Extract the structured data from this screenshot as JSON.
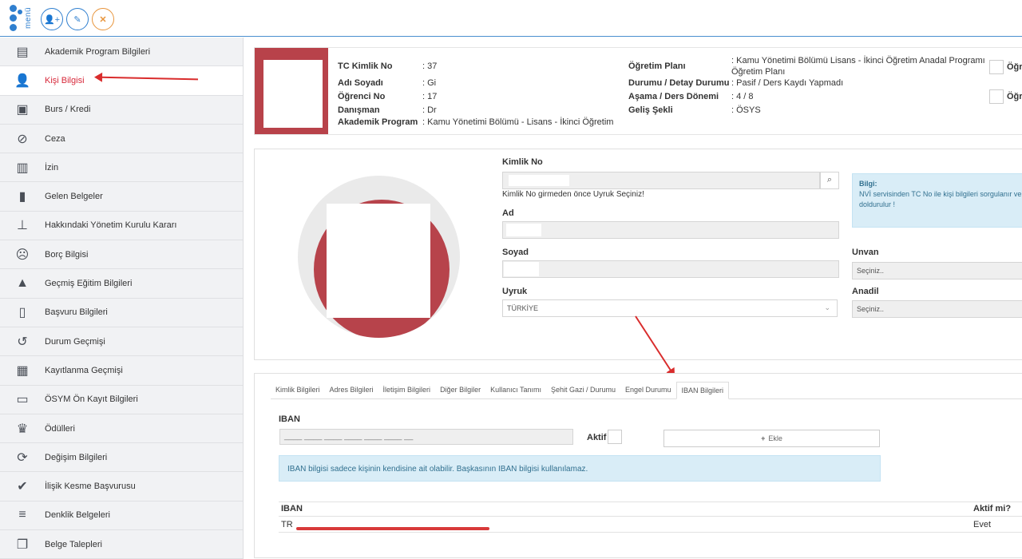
{
  "topbar": {
    "menu_label": "menü",
    "buttons": [
      "add-user",
      "edit",
      "close"
    ]
  },
  "sidebar": {
    "items": [
      {
        "label": "Akademik Program Bilgileri",
        "icon": "table-icon",
        "glyph": "▤"
      },
      {
        "label": "Kişi Bilgisi",
        "icon": "user-icon",
        "glyph": "👤"
      },
      {
        "label": "Burs / Kredi",
        "icon": "money-icon",
        "glyph": "▣"
      },
      {
        "label": "Ceza",
        "icon": "ban-icon",
        "glyph": "⊘"
      },
      {
        "label": "İzin",
        "icon": "briefcase-icon",
        "glyph": "▥"
      },
      {
        "label": "Gelen Belgeler",
        "icon": "file-icon",
        "glyph": "▮"
      },
      {
        "label": "Hakkındaki Yönetim Kurulu Kararı",
        "icon": "pin-icon",
        "glyph": "⊥"
      },
      {
        "label": "Borç Bilgisi",
        "icon": "frown-icon",
        "glyph": "☹"
      },
      {
        "label": "Geçmiş Eğitim Bilgileri",
        "icon": "graduation-cap-icon",
        "glyph": "▲"
      },
      {
        "label": "Başvuru Bilgileri",
        "icon": "document-icon",
        "glyph": "▯"
      },
      {
        "label": "Durum Geçmişi",
        "icon": "history-icon",
        "glyph": "↺"
      },
      {
        "label": "Kayıtlanma Geçmişi",
        "icon": "calendar-check-icon",
        "glyph": "▦"
      },
      {
        "label": "ÖSYM Ön Kayıt Bilgileri",
        "icon": "archive-icon",
        "glyph": "▭"
      },
      {
        "label": "Ödülleri",
        "icon": "trophy-icon",
        "glyph": "♛"
      },
      {
        "label": "Değişim Bilgileri",
        "icon": "refresh-icon",
        "glyph": "⟳"
      },
      {
        "label": "İlişik Kesme Başvurusu",
        "icon": "check-icon",
        "glyph": "✔"
      },
      {
        "label": "Denklik Belgeleri",
        "icon": "bars-icon",
        "glyph": "≡"
      },
      {
        "label": "Belge Talepleri",
        "icon": "copy-icon",
        "glyph": "❐"
      }
    ],
    "active_index": 1
  },
  "student": {
    "tc_label": "TC Kimlik No",
    "tc_value": ": 37",
    "name_label": "Adı Soyadı",
    "name_value": ": Gi",
    "no_label": "Öğrenci No",
    "no_value": ": 17",
    "advisor_label": "Danışman",
    "advisor_value": ": Dr",
    "program_label": "Akademik Program",
    "program_value": ": Kamu Yönetimi Bölümü - Lisans - İkinci Öğretim",
    "plan_label": "Öğretim Planı",
    "plan_value_1": ": Kamu Yönetimi Bölümü Lisans - İkinci Öğretim Anadal Programı",
    "plan_value_2": "Öğretim Planı",
    "status_label": "Durumu / Detay Durumu",
    "status_value": ": Pasif / Ders Kaydı Yapmadı",
    "stage_label": "Aşama / Ders Dönemi",
    "stage_value": ": 4 / 8",
    "entry_label": "Geliş Şekli",
    "entry_value": ": ÖSYS",
    "right_cut_1": "Öğre",
    "right_cut_2": "Öğre"
  },
  "identity": {
    "kimlik_label": "Kimlik No",
    "kimlik_hint": "Kimlik No girmeden önce Uyruk Seçiniz!",
    "ad_label": "Ad",
    "ad_value": "·",
    "soyad_label": "Soyad",
    "uyruk_label": "Uyruk",
    "uyruk_value": "TÜRKİYE",
    "unvan_label": "Unvan",
    "unvan_value": "Seçiniz..",
    "anadil_label": "Anadil",
    "anadil_value": "Seçiniz..",
    "info_title": "Bilgi:",
    "info_text_1": "NVİ servisinden TC No ile kişi bilgileri sorgulanır ve e",
    "info_text_2": "doldurulur !"
  },
  "tabs": [
    "Kimlik Bilgileri",
    "Adres Bilgileri",
    "İletişim Bilgileri",
    "Diğer Bilgiler",
    "Kullanıcı Tanımı",
    "Şehit Gazi / Durumu",
    "Engel Durumu",
    "IBAN Bilgileri"
  ],
  "active_tab": 7,
  "iban": {
    "label": "IBAN",
    "mask": "____ ____ ____ ____ ____ ____ __",
    "aktif_label": "Aktif",
    "add_label": "Ekle",
    "notice": "IBAN bilgisi sadece kişinin kendisine ait olabilir. Başkasının IBAN bilgisi kullanılamaz.",
    "col_iban": "IBAN",
    "col_active": "Aktif mi?",
    "row_iban": "TR",
    "row_active": "Evet"
  },
  "colors": {
    "accent": "#2f7fcf",
    "danger": "#d7283a",
    "warning": "#e8953c"
  }
}
